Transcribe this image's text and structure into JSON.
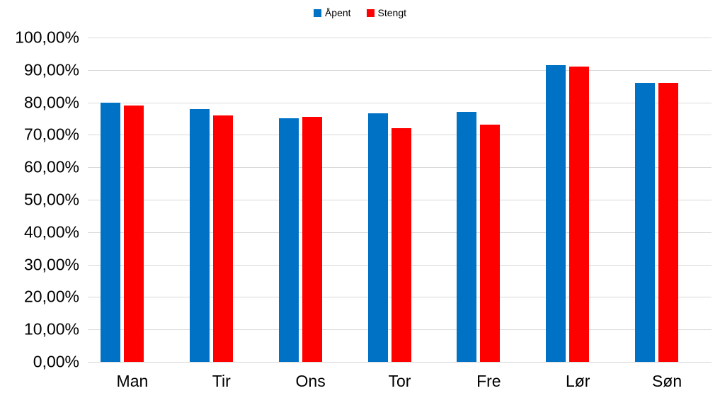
{
  "chart_data": {
    "type": "bar",
    "title": "",
    "subtitle": "",
    "xlabel": "",
    "ylabel": "",
    "categories": [
      "Man",
      "Tir",
      "Ons",
      "Tor",
      "Fre",
      "Lør",
      "Søn"
    ],
    "series": [
      {
        "name": "Åpent",
        "color": "#0072C6",
        "values": [
          80.0,
          78.0,
          75.2,
          76.7,
          77.0,
          91.4,
          86.0
        ]
      },
      {
        "name": "Stengt",
        "color": "#FF0000",
        "values": [
          79.0,
          76.0,
          75.6,
          72.0,
          73.2,
          91.0,
          86.0
        ]
      }
    ],
    "ylim": [
      0,
      100
    ],
    "y_ticks": [
      0,
      10,
      20,
      30,
      40,
      50,
      60,
      70,
      80,
      90,
      100
    ],
    "y_tick_labels": [
      "0,00%",
      "10,00%",
      "20,00%",
      "30,00%",
      "40,00%",
      "50,00%",
      "60,00%",
      "70,00%",
      "80,00%",
      "90,00%",
      "100,00%"
    ],
    "grid": true,
    "grid_color": "#D9D9D9",
    "legend_position": "top",
    "value_format": "percent-comma-decimal"
  },
  "legend": {
    "entries": [
      {
        "label": "Åpent",
        "color": "#0072C6"
      },
      {
        "label": "Stengt",
        "color": "#FF0000"
      }
    ]
  }
}
